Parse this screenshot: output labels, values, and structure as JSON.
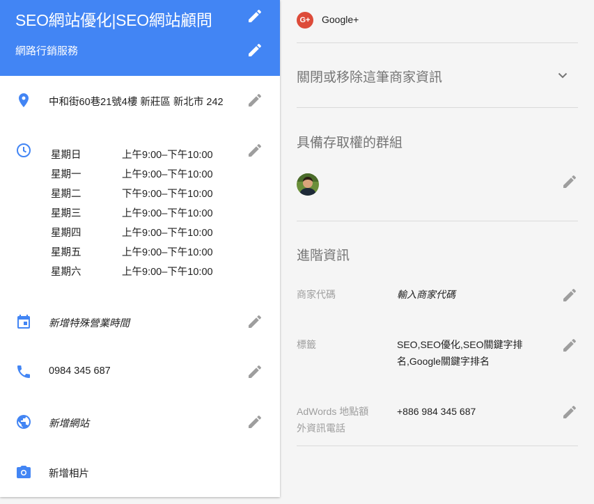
{
  "header": {
    "business_name": "SEO網站優化|SEO網站顧問",
    "category": "網路行銷服務",
    "color": "#4285f4"
  },
  "address": {
    "text": "中和街60巷21號4樓 新莊區 新北市 242"
  },
  "hours": [
    {
      "day": "星期日",
      "time": "上午9:00–下午10:00"
    },
    {
      "day": "星期一",
      "time": "上午9:00–下午10:00"
    },
    {
      "day": "星期二",
      "time": "下午9:00–下午10:00"
    },
    {
      "day": "星期三",
      "time": "上午9:00–下午10:00"
    },
    {
      "day": "星期四",
      "time": "上午9:00–下午10:00"
    },
    {
      "day": "星期五",
      "time": "上午9:00–下午10:00"
    },
    {
      "day": "星期六",
      "time": "上午9:00–下午10:00"
    }
  ],
  "special_hours": {
    "text": "新增特殊營業時間"
  },
  "phone": {
    "text": "0984 345 687"
  },
  "website": {
    "text": "新增網站"
  },
  "photos": {
    "text": "新增相片"
  },
  "right": {
    "gplus": {
      "label": "Google+"
    },
    "close_listing": "關閉或移除這筆商家資訊",
    "access_group_title": "具備存取權的群組",
    "advanced_title": "進階資訊",
    "store_code": {
      "label": "商家代碼",
      "value": "輸入商家代碼"
    },
    "labels": {
      "label": "標籤",
      "value_line1": "SEO,SEO優化,SEO關鍵字排",
      "value_line2": "名,Google關鍵字排名"
    },
    "adwords": {
      "label_line1": "AdWords 地點額",
      "label_line2": "外資訊電話",
      "value": "+886 984 345 687"
    }
  },
  "icons": [
    "edit-icon",
    "location-pin-icon",
    "clock-icon",
    "calendar-icon",
    "phone-icon",
    "globe-icon",
    "camera-icon",
    "google-plus-icon",
    "chevron-down-icon"
  ]
}
